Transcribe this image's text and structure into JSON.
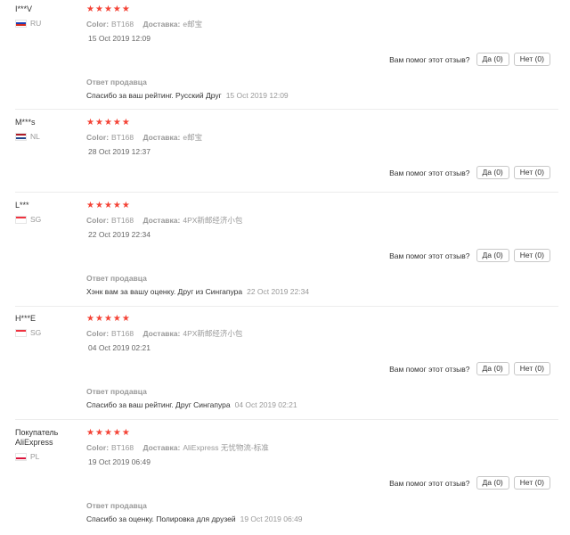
{
  "labels": {
    "color": "Color:",
    "delivery": "Доставка:",
    "helpful_question": "Вам помог этот отзыв?",
    "reply_label": "Ответ продавца"
  },
  "star_color": "#f44336",
  "reviews": [
    {
      "name": "I***V",
      "country": "RU",
      "flag": [
        "#ffffff",
        "#1c3fb5",
        "#d52b1e"
      ],
      "stars": 5,
      "color": "BT168",
      "delivery": "e邮宝",
      "date": "15 Oct 2019 12:09",
      "yes": "Да (0)",
      "no": "Нет (0)",
      "reply": "Спасибо за ваш рейтинг. Русский Друг",
      "reply_date": "15 Oct 2019 12:09"
    },
    {
      "name": "M***s",
      "country": "NL",
      "flag": [
        "#ae1c28",
        "#ffffff",
        "#21468b"
      ],
      "stars": 5,
      "color": "BT168",
      "delivery": "e邮宝",
      "date": "28 Oct 2019 12:37",
      "yes": "Да (0)",
      "no": "Нет (0)"
    },
    {
      "name": "L***",
      "country": "SG",
      "flag": [
        "#ef3340",
        "#ffffff",
        "#ffffff"
      ],
      "stars": 5,
      "color": "BT168",
      "delivery": "4PX新邮经济小包",
      "date": "22 Oct 2019 22:34",
      "yes": "Да (0)",
      "no": "Нет (0)",
      "reply": "Хэнк вам за вашу оценку. Друг из Сингапура",
      "reply_date": "22 Oct 2019 22:34"
    },
    {
      "name": "H***E",
      "country": "SG",
      "flag": [
        "#ef3340",
        "#ffffff",
        "#ffffff"
      ],
      "stars": 5,
      "color": "BT168",
      "delivery": "4PX新邮经济小包",
      "date": "04 Oct 2019 02:21",
      "yes": "Да (0)",
      "no": "Нет (0)",
      "reply": "Спасибо за ваш рейтинг. Друг Сингапура",
      "reply_date": "04 Oct 2019 02:21"
    },
    {
      "name": "Покупатель AliExpress",
      "country": "PL",
      "flag": [
        "#ffffff",
        "#ffffff",
        "#dc143c"
      ],
      "stars": 5,
      "color": "BT168",
      "delivery": "AliExpress 无忧物流-标准",
      "date": "19 Oct 2019 06:49",
      "yes": "Да (0)",
      "no": "Нет (0)",
      "reply": "Спасибо за оценку. Полировка для друзей",
      "reply_date": "19 Oct 2019 06:49"
    }
  ]
}
